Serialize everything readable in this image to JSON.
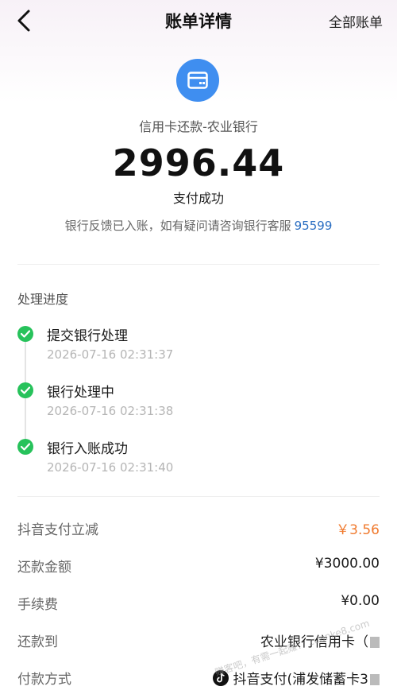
{
  "nav": {
    "title": "账单详情",
    "right_link": "全部账单"
  },
  "header": {
    "merchant": "信用卡还款-农业银行",
    "amount": "2996.44",
    "status": "支付成功",
    "notice_text": "银行反馈已入账，如有疑问请咨询银行客服",
    "notice_phone": "95599",
    "icon_color": "#3f8ef0"
  },
  "progress": {
    "title": "处理进度",
    "steps": [
      {
        "label": "提交银行处理",
        "time": "2026-07-16 02:31:37"
      },
      {
        "label": "银行处理中",
        "time": "2026-07-16 02:31:38"
      },
      {
        "label": "银行入账成功",
        "time": "2026-07-16 02:31:40"
      }
    ],
    "check_color": "#27c25b"
  },
  "details": [
    {
      "label": "抖音支付立减",
      "value": "￥3.56"
    },
    {
      "label": "还款金额",
      "value": "¥3000.00"
    },
    {
      "label": "手续费",
      "value": "¥0.00"
    },
    {
      "label": "还款到",
      "value": "农业银行信用卡（"
    },
    {
      "label": "付款方式",
      "value": "抖音支付(浦发储蓄卡3"
    }
  ],
  "watermark": "赚客吧，有需一起赚！ zuanke8.com"
}
